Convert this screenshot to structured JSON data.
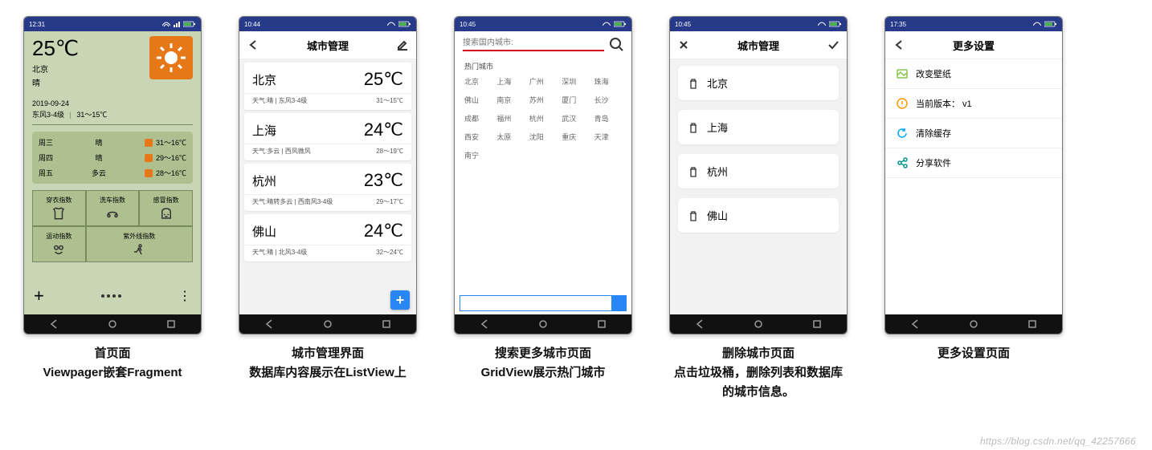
{
  "watermark": "https://blog.csdn.net/qq_42257666",
  "screen1": {
    "status_time": "12:31",
    "temp": "25℃",
    "city": "北京",
    "cond": "晴",
    "date": "2019-09-24",
    "wind": "东风3-4级",
    "range": "31～15℃",
    "forecast": [
      {
        "day": "周三",
        "cond": "晴",
        "range": "31～16℃"
      },
      {
        "day": "周四",
        "cond": "晴",
        "range": "29～16℃"
      },
      {
        "day": "周五",
        "cond": "多云",
        "range": "28～16℃"
      }
    ],
    "indices": [
      "穿衣指数",
      "洗车指数",
      "感冒指数",
      "运动指数",
      "紫外线指数",
      ""
    ],
    "caption_line1": "首页面",
    "caption_line2": "Viewpager嵌套Fragment"
  },
  "screen2": {
    "status_time": "10:44",
    "title": "城市管理",
    "items": [
      {
        "city": "北京",
        "temp": "25℃",
        "desc": "天气:晴 | 东风3-4级",
        "range": "31～15℃"
      },
      {
        "city": "上海",
        "temp": "24℃",
        "desc": "天气:多云 | 西风微风",
        "range": "28～19℃"
      },
      {
        "city": "杭州",
        "temp": "23℃",
        "desc": "天气:晴转多云 | 西南风3-4级",
        "range": "29～17℃"
      },
      {
        "city": "佛山",
        "temp": "24℃",
        "desc": "天气:晴 | 北风3-4级",
        "range": "32～24℃"
      }
    ],
    "caption_line1": "城市管理界面",
    "caption_line2": "数据库内容展示在ListView上"
  },
  "screen3": {
    "status_time": "10:45",
    "placeholder": "搜索国内城市:",
    "section_title": "热门城市",
    "cities": [
      "北京",
      "上海",
      "广州",
      "深圳",
      "珠海",
      "佛山",
      "南京",
      "苏州",
      "厦门",
      "长沙",
      "成都",
      "福州",
      "杭州",
      "武汉",
      "青岛",
      "西安",
      "太原",
      "沈阳",
      "重庆",
      "天津",
      "南宁"
    ],
    "caption_line1": "搜索更多城市页面",
    "caption_line2": "GridView展示热门城市"
  },
  "screen4": {
    "status_time": "10:45",
    "title": "城市管理",
    "items": [
      "北京",
      "上海",
      "杭州",
      "佛山"
    ],
    "caption_line1": "删除城市页面",
    "caption_line2": "点击垃圾桶，删除列表和数据库的城市信息。"
  },
  "screen5": {
    "status_time": "17:35",
    "title": "更多设置",
    "items": [
      {
        "icon": "wallpaper",
        "color": "#8bc34a",
        "label": "改变壁纸"
      },
      {
        "icon": "version",
        "color": "#ff9800",
        "label": "当前版本： v1"
      },
      {
        "icon": "refresh",
        "color": "#03a9f4",
        "label": "清除缓存"
      },
      {
        "icon": "share",
        "color": "#009688",
        "label": "分享软件"
      }
    ],
    "caption": "更多设置页面"
  }
}
